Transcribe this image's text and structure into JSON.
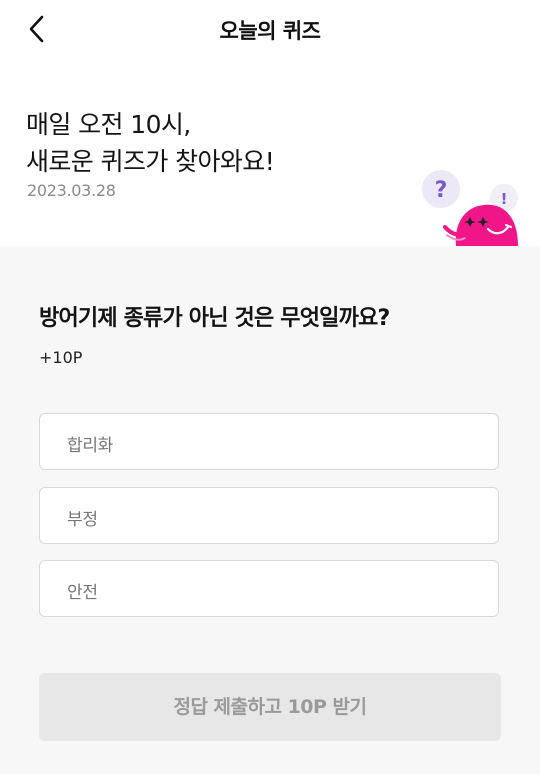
{
  "header": {
    "back_icon": "chevron-left-icon",
    "title": "오늘의 퀴즈"
  },
  "hero": {
    "line1": "매일 오전 10시,",
    "line2": "새로운 퀴즈가 찾아와요!",
    "date": "2023.03.28",
    "mascot": {
      "question_mark": "?",
      "exclaim_mark": "!",
      "body_color": "#f0168a",
      "question_color": "#7a5ad0"
    }
  },
  "quiz": {
    "question": "방어기제 종류가 아닌 것은 무엇일까요?",
    "points": "+10P",
    "options": [
      {
        "label": "합리화"
      },
      {
        "label": "부정"
      },
      {
        "label": "안전"
      }
    ],
    "submit_label": "정답 제출하고 10P 받기",
    "submit_enabled": false
  },
  "colors": {
    "background": "#ffffff",
    "section_background": "#f7f7f7",
    "option_border": "#d8d8d8",
    "submit_disabled_bg": "#e7e7e7",
    "submit_disabled_text": "#9a9a9a"
  }
}
